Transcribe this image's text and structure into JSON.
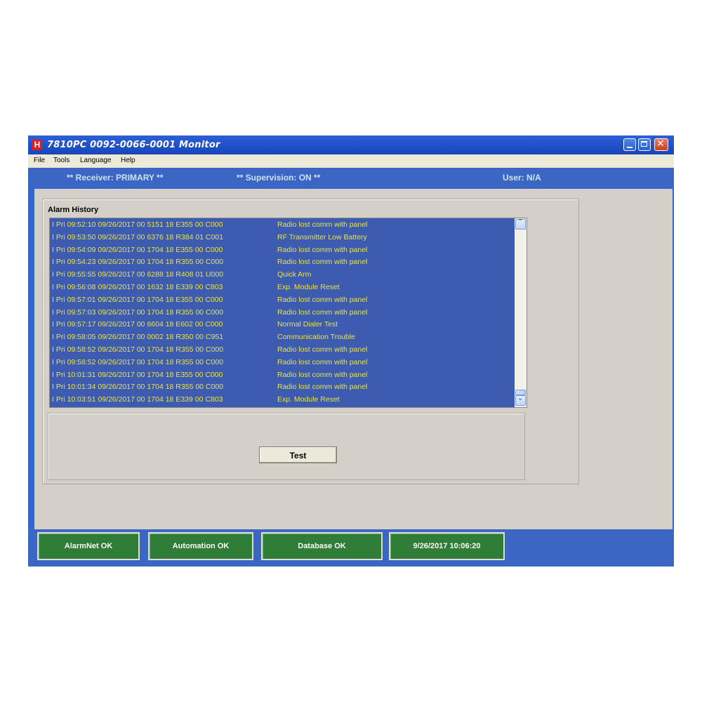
{
  "window": {
    "title": "7810PC  0092-0066-0001 Monitor",
    "app_icon": "H"
  },
  "menu": [
    "File",
    "Tools",
    "Language",
    "Help"
  ],
  "statusline": {
    "receiver": "** Receiver: PRIMARY **",
    "supervision": "** Supervision: ON **",
    "user": "User: N/A"
  },
  "alarm_history": {
    "label": "Alarm History",
    "rows": [
      {
        "code": "I Pri 09:52:10 09/26/2017 00 5151 18 E355 00 C000",
        "desc": "Radio lost comm with panel"
      },
      {
        "code": "I Pri 09:53:50 09/26/2017 00 6376 18 R384 01 C001",
        "desc": "RF Transmitter Low Battery"
      },
      {
        "code": "I Pri 09:54:09 09/26/2017 00 1704 18 E355 00 C000",
        "desc": "Radio lost comm with panel"
      },
      {
        "code": "I Pri 09:54:23 09/26/2017 00 1704 18 R355 00 C000",
        "desc": "Radio lost comm with panel"
      },
      {
        "code": "I Pri 09:55:55 09/26/2017 00 6288 18 R408 01 U000",
        "desc": "Quick Arm"
      },
      {
        "code": "I Pri 09:56:08 09/26/2017 00 1632 18 E339 00 C803",
        "desc": "Exp. Module Reset"
      },
      {
        "code": "I Pri 09:57:01 09/26/2017 00 1704 18 E355 00 C000",
        "desc": "Radio lost comm with panel"
      },
      {
        "code": "I Pri 09:57:03 09/26/2017 00 1704 18 R355 00 C000",
        "desc": "Radio lost comm with panel"
      },
      {
        "code": "I Pri 09:57:17 09/26/2017 00 6604 18 E602 00 C000",
        "desc": "Normal Dialer Test"
      },
      {
        "code": "I Pri 09:58:05 09/26/2017 00 0002 18 R350 00 C951",
        "desc": "Communication Trouble"
      },
      {
        "code": "I Pri 09:58:52 09/26/2017 00 1704 18 R355 00 C000",
        "desc": "Radio lost comm with panel"
      },
      {
        "code": "I Pri 09:58:52 09/26/2017 00 1704 18 R355 00 C000",
        "desc": "Radio lost comm with panel"
      },
      {
        "code": "I Pri 10:01:31 09/26/2017 00 1704 18 E355 00 C000",
        "desc": "Radio lost comm with panel"
      },
      {
        "code": "I Pri 10:01:34 09/26/2017 00 1704 18 R355 00 C000",
        "desc": "Radio lost comm with panel"
      },
      {
        "code": "I Pri 10:03:51 09/26/2017 00 1704 18 E339 00 C803",
        "desc": "Exp. Module Reset"
      }
    ]
  },
  "test_button": "Test",
  "status_buttons": [
    "AlarmNet OK",
    "Automation OK",
    "Database OK",
    "9/26/2017 10:06:20"
  ],
  "colors": {
    "list_bg": "#3d5bb0",
    "list_text": "#e8e44a",
    "status_green": "#2f7d36",
    "frame_blue": "#3b66c4"
  }
}
